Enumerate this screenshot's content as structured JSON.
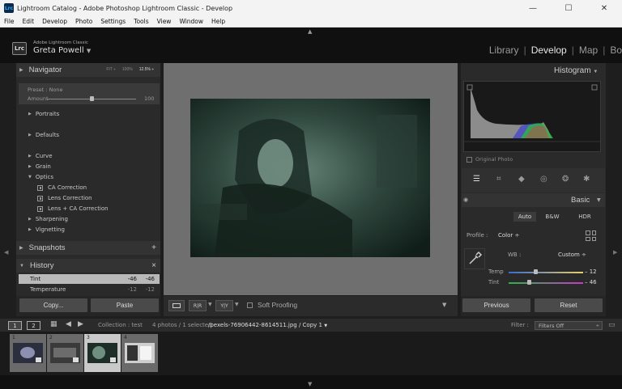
{
  "window": {
    "title": "Lightroom Catalog - Adobe Photoshop Lightroom Classic - Develop",
    "app_icon": "Lrc",
    "controls": [
      "—",
      "☐",
      "✕"
    ]
  },
  "menu": [
    "File",
    "Edit",
    "Develop",
    "Photo",
    "Settings",
    "Tools",
    "View",
    "Window",
    "Help"
  ],
  "identity": {
    "badge": "Lrc",
    "brand": "Adobe Lightroom Classic",
    "user": "Greta Powell",
    "modules": [
      "Library",
      "Develop",
      "Map",
      "Bo"
    ],
    "active_module": "Develop"
  },
  "left": {
    "navigator": {
      "title": "Navigator",
      "zoom": [
        "FIT ÷",
        "100%",
        "12.5% ÷"
      ]
    },
    "preset_label": "Preset :  None",
    "amount_label": "Amount",
    "amount_value": "100",
    "amount_fraction": 0.5,
    "tree": [
      {
        "label": "Portraits",
        "open": false
      },
      {
        "label": "Defaults",
        "open": false
      },
      {
        "label": "Curve",
        "open": false
      },
      {
        "label": "Grain",
        "open": false
      },
      {
        "label": "Optics",
        "open": true
      }
    ],
    "optics_presets": [
      "CA Correction",
      "Lens Correction",
      "Lens + CA Correction"
    ],
    "tree_more": [
      {
        "label": "Sharpening"
      },
      {
        "label": "Vignetting"
      }
    ],
    "snapshots": {
      "title": "Snapshots",
      "action": "+"
    },
    "history": {
      "title": "History",
      "action": "×",
      "rows": [
        {
          "label": "Tint",
          "v1": "-46",
          "v2": "-46",
          "selected": true
        },
        {
          "label": "Temperature",
          "v1": "-12",
          "v2": "-12",
          "selected": false
        }
      ]
    },
    "copy_label": "Copy...",
    "paste_label": "Paste"
  },
  "toolbar": {
    "soft_proofing": "Soft Proofing",
    "yy_label": "Y|Y"
  },
  "right": {
    "histogram_title": "Histogram",
    "original_photo": "Original Photo",
    "basic_title": "Basic",
    "treatments": [
      "Auto",
      "B&W",
      "HDR"
    ],
    "profile_label": "Profile :",
    "profile_value": "Color ÷",
    "wb_label": "WB :",
    "wb_value": "Custom ÷",
    "sliders": [
      {
        "label": "Temp",
        "value": "– 12",
        "fraction": 0.36
      },
      {
        "label": "Tint",
        "value": "– 46",
        "fraction": 0.27
      }
    ],
    "previous_label": "Previous",
    "reset_label": "Reset"
  },
  "filmstrip": {
    "screens": [
      "1",
      "2"
    ],
    "collection": "Collection : test",
    "count": "4 photos / 1 selected",
    "filename": "/pexels-76906442-8614511.jpg / Copy 1",
    "filter_label": "Filter :",
    "filter_value": "Filters Off",
    "thumbs": [
      {
        "num": "1",
        "selected": false
      },
      {
        "num": "2",
        "selected": false
      },
      {
        "num": "3",
        "selected": true
      },
      {
        "num": "4",
        "selected": false
      }
    ]
  },
  "colors": {
    "temp_gradient": [
      "#3a6bd0",
      "#e8d06a"
    ],
    "tint_gradient": [
      "#2fb24a",
      "#c63ac9"
    ]
  }
}
